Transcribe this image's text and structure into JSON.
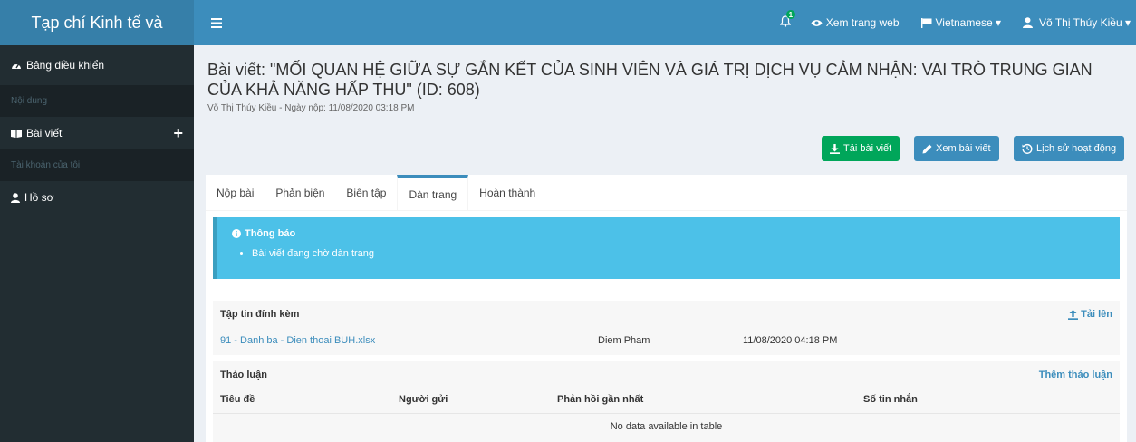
{
  "brand": "Tạp chí Kinh tế và",
  "navbar": {
    "notification_count": "1",
    "view_site": "Xem trang web",
    "language": "Vietnamese ▾",
    "user": "Võ Thị Thúy Kiều ▾"
  },
  "sidebar": {
    "dashboard": "Bảng điều khiển",
    "section_content": "Nội dung",
    "articles": "Bài viết",
    "plus": "+",
    "section_account": "Tài khoản của tôi",
    "profile": "Hồ sơ"
  },
  "page": {
    "title": "Bài viết: \"MỐI QUAN HỆ GIỮA SỰ GẮN KẾT CỦA SINH VIÊN VÀ GIÁ TRỊ DỊCH VỤ CẢM NHẬN: VAI TRÒ TRUNG GIAN CỦA KHẢ NĂNG HẤP THU\" (ID: 608)",
    "meta": "Võ Thị Thúy Kiều - Ngày nộp: 11/08/2020 03:18 PM"
  },
  "buttons": {
    "download": "Tải bài viết",
    "view": "Xem bài viết",
    "history": "Lịch sử hoạt động"
  },
  "tabs": [
    "Nộp bài",
    "Phản biện",
    "Biên tập",
    "Dàn trang",
    "Hoàn thành"
  ],
  "notice": {
    "title": "Thông báo",
    "item": "Bài viết đang chờ dàn trang"
  },
  "attachments": {
    "title": "Tập tin đính kèm",
    "upload": "Tải lên",
    "file": {
      "name": "91 - Danh ba - Dien thoai BUH.xlsx",
      "sender": "Diem Pham",
      "date": "11/08/2020 04:18 PM"
    }
  },
  "discussion": {
    "title": "Thảo luận",
    "add": "Thêm thảo luận",
    "columns": [
      "Tiêu đề",
      "Người gửi",
      "Phản hồi gần nhất",
      "Số tin nhắn"
    ],
    "empty": "No data available in table"
  }
}
